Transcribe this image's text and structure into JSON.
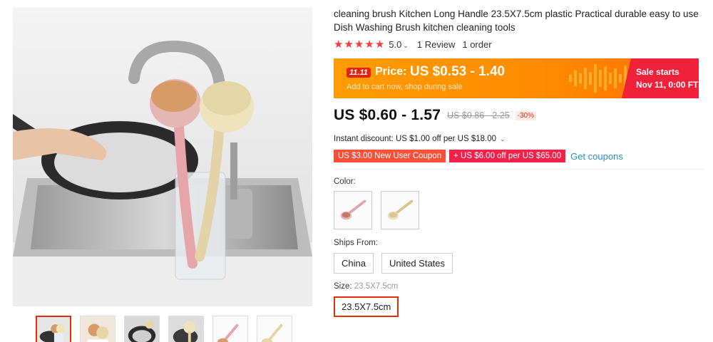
{
  "product": {
    "title": "cleaning brush Kitchen Long Handle 23.5X7.5cm plastic Practical durable easy to use Dish Washing Brush kitchen cleaning tools"
  },
  "rating": {
    "score": "5.0",
    "stars": 5,
    "reviews": "1 Review",
    "orders": "1 order",
    "star_color": "#f63b3b"
  },
  "promo": {
    "badge": "11.11",
    "price_label": "Price:",
    "price": "US $0.53 - 1.40",
    "subtext": "Add to cart now, shop during sale",
    "sale_line1": "Sale starts",
    "sale_line2": "Nov 11, 0:00 FT",
    "banner_color": "#ff8a00",
    "sale_color": "#f2213a"
  },
  "price": {
    "current": "US $0.60 - 1.57",
    "original": "US $0.86 - 2.25",
    "discount": "-30%"
  },
  "instant_discount": "Instant discount: US $1.00 off per US $18.00",
  "coupons": {
    "new_user": "US $3.00 New User Coupon",
    "store": "+ US $6.00 off per US $65.00",
    "get": "Get coupons"
  },
  "color": {
    "label": "Color:",
    "options": [
      "pink",
      "beige"
    ]
  },
  "ships_from": {
    "label": "Ships From:",
    "options": [
      "China",
      "United States"
    ]
  },
  "size": {
    "label": "Size:",
    "selected_value": "23.5X7.5cm",
    "options": [
      "23.5X7.5cm"
    ]
  },
  "colors": {
    "accent": "#e62e04",
    "link": "#2a8fb8"
  }
}
